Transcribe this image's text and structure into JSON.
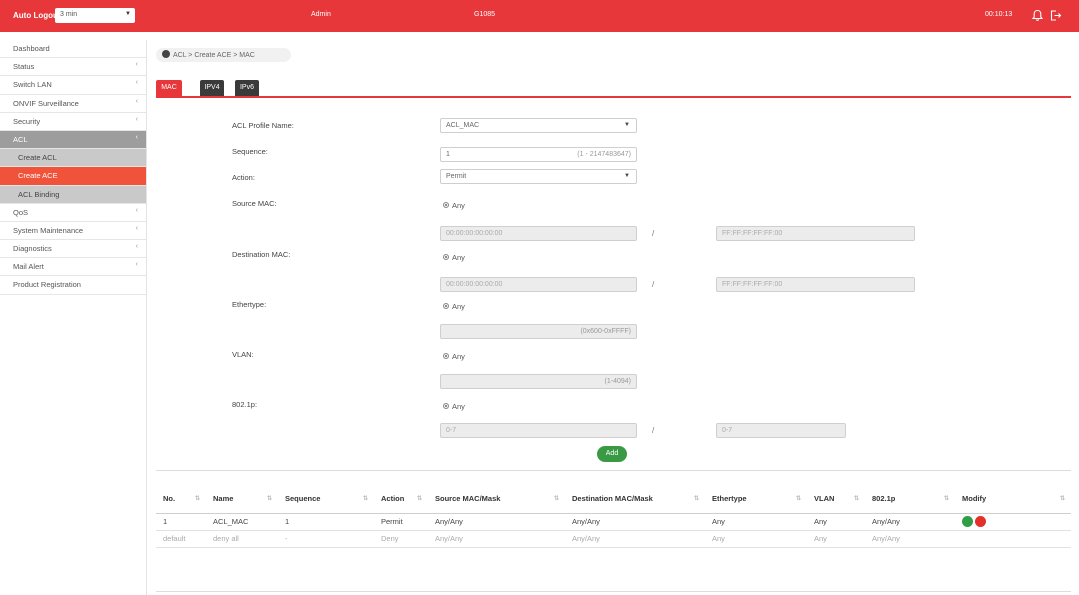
{
  "topbar": {
    "auto_logout_label": "Auto Logout",
    "auto_logout_value": "3 min",
    "user": "Admin",
    "model": "G1085",
    "time": "00:10:13",
    "bell_icon": "bell-icon",
    "logout_icon": "logout-icon"
  },
  "sidebar": {
    "items": [
      {
        "label": "Dashboard",
        "arrow": ""
      },
      {
        "label": "Status",
        "arrow": "‹"
      },
      {
        "label": "Switch LAN",
        "arrow": "‹"
      },
      {
        "label": "ONVIF Surveillance",
        "arrow": "‹"
      },
      {
        "label": "Security",
        "arrow": "‹"
      },
      {
        "label": "ACL",
        "arrow": "‹"
      },
      {
        "label": "Create ACL",
        "arrow": ""
      },
      {
        "label": "Create ACE",
        "arrow": ""
      },
      {
        "label": "ACL Binding",
        "arrow": ""
      },
      {
        "label": "QoS",
        "arrow": "‹"
      },
      {
        "label": "System Maintenance",
        "arrow": "‹"
      },
      {
        "label": "Diagnostics",
        "arrow": "‹"
      },
      {
        "label": "Mail Alert",
        "arrow": "‹"
      },
      {
        "label": "Product Registration",
        "arrow": ""
      }
    ]
  },
  "breadcrumb": "ACL > Create ACE > MAC",
  "tabs": [
    "MAC",
    "IPV4",
    "IPv6"
  ],
  "form": {
    "acl_profile_name_label": "ACL Profile Name:",
    "acl_profile_name_value": "ACL_MAC",
    "sequence_label": "Sequence:",
    "sequence_value": "1",
    "sequence_hint": "(1 - 2147483647)",
    "action_label": "Action:",
    "action_value": "Permit",
    "source_mac_label": "Source MAC:",
    "source_mac_any": "Any",
    "source_mac_value": "00:00:00:00:00:00",
    "source_mac_mask": "FF:FF:FF:FF:FF:00",
    "dest_mac_label": "Destination MAC:",
    "dest_mac_any": "Any",
    "dest_mac_value": "00:00:00:00:00:00",
    "dest_mac_mask": "FF:FF:FF:FF:FF:00",
    "ethertype_label": "Ethertype:",
    "ethertype_any": "Any",
    "ethertype_hint": "(0x600-0xFFFF)",
    "vlan_label": "VLAN:",
    "vlan_any": "Any",
    "vlan_hint": "(1-4094)",
    "p8021p_label": "802.1p:",
    "p8021p_any": "Any",
    "p8021p_value": "0-7",
    "p8021p_mask": "0-7",
    "slash": "/",
    "add_label": "Add"
  },
  "table": {
    "headers": [
      "No.",
      "Name",
      "Sequence",
      "Action",
      "Source MAC/Mask",
      "Destination MAC/Mask",
      "Ethertype",
      "VLAN",
      "802.1p",
      "Modify"
    ],
    "rows": [
      [
        "1",
        "ACL_MAC",
        "1",
        "Permit",
        "Any/Any",
        "Any/Any",
        "Any",
        "Any",
        "Any/Any",
        ""
      ],
      [
        "default",
        "deny all",
        "-",
        "Deny",
        "Any/Any",
        "Any/Any",
        "Any",
        "Any",
        "Any/Any",
        ""
      ]
    ]
  }
}
